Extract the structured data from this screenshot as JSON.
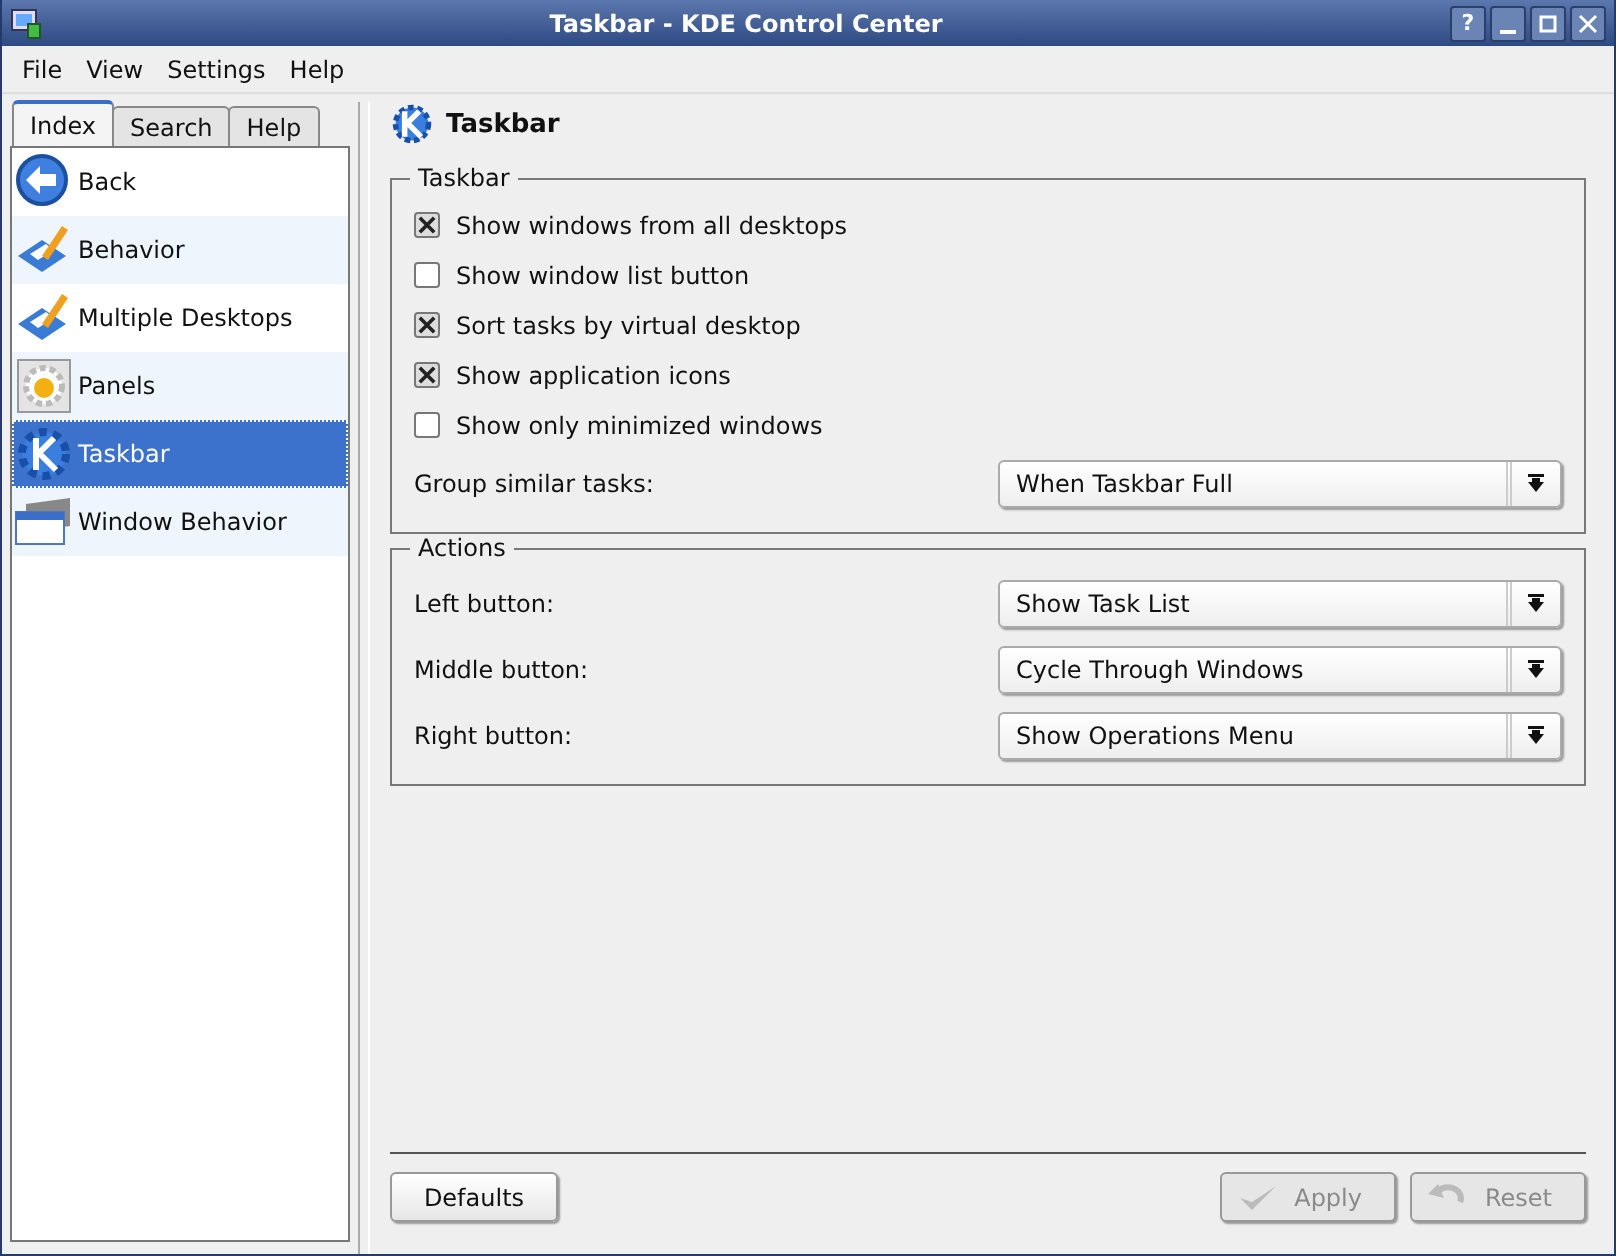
{
  "window": {
    "title": "Taskbar - KDE Control Center",
    "help_button": "?"
  },
  "menu": [
    "File",
    "View",
    "Settings",
    "Help"
  ],
  "tabs": [
    {
      "label": "Index",
      "selected": true
    },
    {
      "label": "Search",
      "selected": false
    },
    {
      "label": "Help",
      "selected": false
    }
  ],
  "sidebar": {
    "items": [
      {
        "label": "Back",
        "selected": false
      },
      {
        "label": "Behavior",
        "selected": false
      },
      {
        "label": "Multiple Desktops",
        "selected": false
      },
      {
        "label": "Panels",
        "selected": false
      },
      {
        "label": "Taskbar",
        "selected": true
      },
      {
        "label": "Window Behavior",
        "selected": false
      }
    ]
  },
  "module": {
    "title": "Taskbar"
  },
  "groups": [
    {
      "title": "Taskbar",
      "rows": [
        {
          "kind": "checkbox",
          "label": "Show windows from all desktops",
          "checked": true
        },
        {
          "kind": "checkbox",
          "label": "Show window list button",
          "checked": false
        },
        {
          "kind": "checkbox",
          "label": "Sort tasks by virtual desktop",
          "checked": true
        },
        {
          "kind": "checkbox",
          "label": "Show application icons",
          "checked": true
        },
        {
          "kind": "checkbox",
          "label": "Show only minimized windows",
          "checked": false
        },
        {
          "kind": "combo",
          "label": "Group similar tasks:",
          "value": "When Taskbar Full"
        }
      ]
    },
    {
      "title": "Actions",
      "rows": [
        {
          "kind": "combo",
          "label": "Left button:",
          "value": "Show Task List"
        },
        {
          "kind": "combo",
          "label": "Middle button:",
          "value": "Cycle Through Windows"
        },
        {
          "kind": "combo",
          "label": "Right button:",
          "value": "Show Operations Menu"
        }
      ]
    }
  ],
  "buttons": [
    {
      "label": "Defaults",
      "disabled": false,
      "kind": "plain"
    },
    {
      "label": "Apply",
      "disabled": true,
      "kind": "apply"
    },
    {
      "label": "Reset",
      "disabled": true,
      "kind": "reset"
    }
  ]
}
